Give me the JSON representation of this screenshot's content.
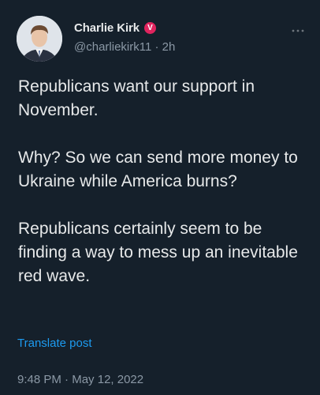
{
  "author": {
    "name": "Charlie Kirk",
    "verified_badge": "V",
    "verified_color": "#e0245e",
    "handle": "@charliekirk11",
    "separator": "·",
    "time_ago": "2h"
  },
  "menu_icon": "more-horizontal-icon",
  "tweet": {
    "paragraphs": [
      "Republicans want our support in November.",
      "Why? So we can send more money to Ukraine while America burns?",
      "Republicans certainly seem to be finding a way to mess up an inevitable red wave."
    ]
  },
  "translate_label": "Translate post",
  "footer": {
    "time": "9:48 PM",
    "separator": "·",
    "date": "May 12, 2022"
  },
  "colors": {
    "background": "#15202b",
    "text": "#e7e9ea",
    "muted": "#8b98a5",
    "link": "#1d9bf0"
  }
}
